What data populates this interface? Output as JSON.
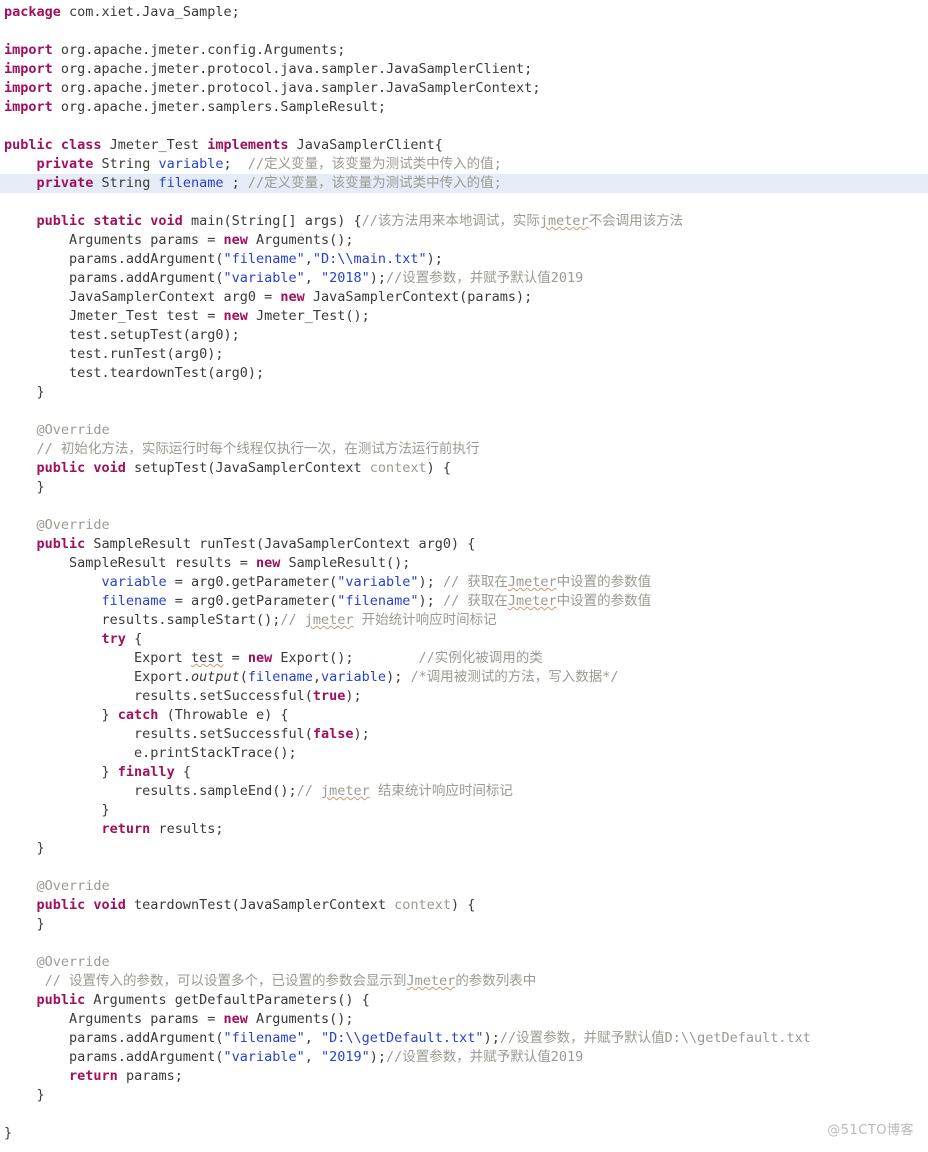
{
  "document": {
    "kind": "java-source-screenshot",
    "language": "Java",
    "watermark": "@51CTO博客",
    "highlighted_line_index": 8
  },
  "theme": {
    "background": "#ffffff",
    "plain_text": "#3a3a38",
    "keyword": "#a0105c",
    "string": "#2741d1",
    "comment": "#9a9a93",
    "field": "#2741d1",
    "annotation": "#9a9a93",
    "current_line_highlight": "#e6ecf7",
    "watermark_color": "#b9b9b9",
    "spellcheck_underline": "#cc9b77"
  },
  "code": {
    "lines": [
      {
        "n": 1,
        "tokens": [
          {
            "t": "package",
            "c": "kw"
          },
          {
            "t": " com.xiet.Java_Sample;",
            "c": "plain"
          }
        ]
      },
      {
        "n": 2,
        "tokens": []
      },
      {
        "n": 3,
        "tokens": [
          {
            "t": "import",
            "c": "kw"
          },
          {
            "t": " org.apache.jmeter.config.Arguments;",
            "c": "plain"
          }
        ]
      },
      {
        "n": 4,
        "tokens": [
          {
            "t": "import",
            "c": "kw"
          },
          {
            "t": " org.apache.jmeter.protocol.java.sampler.JavaSamplerClient;",
            "c": "plain"
          }
        ]
      },
      {
        "n": 5,
        "tokens": [
          {
            "t": "import",
            "c": "kw"
          },
          {
            "t": " org.apache.jmeter.protocol.java.sampler.JavaSamplerContext;",
            "c": "plain"
          }
        ]
      },
      {
        "n": 6,
        "tokens": [
          {
            "t": "import",
            "c": "kw"
          },
          {
            "t": " org.apache.jmeter.samplers.SampleResult;",
            "c": "plain"
          }
        ]
      },
      {
        "n": 7,
        "tokens": []
      },
      {
        "n": 8,
        "tokens": [
          {
            "t": "public class",
            "c": "kw"
          },
          {
            "t": " Jmeter_Test ",
            "c": "plain"
          },
          {
            "t": "implements",
            "c": "kw"
          },
          {
            "t": " JavaSamplerClient{",
            "c": "plain"
          }
        ]
      },
      {
        "n": 9,
        "tokens": [
          {
            "t": "    ",
            "c": "plain"
          },
          {
            "t": "private",
            "c": "kw"
          },
          {
            "t": " String ",
            "c": "plain"
          },
          {
            "t": "variable",
            "c": "fld"
          },
          {
            "t": ";  ",
            "c": "plain"
          },
          {
            "t": "//定义变量，该变量为测试类中传入的值;",
            "c": "cmt"
          }
        ]
      },
      {
        "n": 10,
        "tokens": [
          {
            "t": "    ",
            "c": "plain"
          },
          {
            "t": "private",
            "c": "kw"
          },
          {
            "t": " String ",
            "c": "plain"
          },
          {
            "t": "filename",
            "c": "fld"
          },
          {
            "t": " ; ",
            "c": "plain"
          },
          {
            "t": "//定义变量，该变量为测试类中传入的值;",
            "c": "cmt"
          }
        ]
      },
      {
        "n": 11,
        "tokens": []
      },
      {
        "n": 12,
        "tokens": [
          {
            "t": "    ",
            "c": "plain"
          },
          {
            "t": "public static void",
            "c": "kw"
          },
          {
            "t": " main(String[] args) {",
            "c": "plain"
          },
          {
            "t": "//该方法用来本地调试，实际",
            "c": "cmt"
          },
          {
            "t": "jmeter",
            "c": "cmt wavy"
          },
          {
            "t": "不会调用该方法",
            "c": "cmt"
          }
        ]
      },
      {
        "n": 13,
        "tokens": [
          {
            "t": "        Arguments params = ",
            "c": "plain"
          },
          {
            "t": "new",
            "c": "kw"
          },
          {
            "t": " Arguments();",
            "c": "plain"
          }
        ]
      },
      {
        "n": 14,
        "tokens": [
          {
            "t": "        params.addArgument(",
            "c": "plain"
          },
          {
            "t": "\"filename\"",
            "c": "str"
          },
          {
            "t": ",",
            "c": "plain"
          },
          {
            "t": "\"D:\\\\main.txt\"",
            "c": "str"
          },
          {
            "t": ");",
            "c": "plain"
          }
        ]
      },
      {
        "n": 15,
        "tokens": [
          {
            "t": "        params.addArgument(",
            "c": "plain"
          },
          {
            "t": "\"variable\"",
            "c": "str"
          },
          {
            "t": ", ",
            "c": "plain"
          },
          {
            "t": "\"2018\"",
            "c": "str"
          },
          {
            "t": ");",
            "c": "plain"
          },
          {
            "t": "//设置参数，并赋予默认值2019",
            "c": "cmt"
          }
        ]
      },
      {
        "n": 16,
        "tokens": [
          {
            "t": "        JavaSamplerContext arg0 = ",
            "c": "plain"
          },
          {
            "t": "new",
            "c": "kw"
          },
          {
            "t": " JavaSamplerContext(params);",
            "c": "plain"
          }
        ]
      },
      {
        "n": 17,
        "tokens": [
          {
            "t": "        Jmeter_Test test = ",
            "c": "plain"
          },
          {
            "t": "new",
            "c": "kw"
          },
          {
            "t": " Jmeter_Test();",
            "c": "plain"
          }
        ]
      },
      {
        "n": 18,
        "tokens": [
          {
            "t": "        test.setupTest(arg0);",
            "c": "plain"
          }
        ]
      },
      {
        "n": 19,
        "tokens": [
          {
            "t": "        test.runTest(arg0);",
            "c": "plain"
          }
        ]
      },
      {
        "n": 20,
        "tokens": [
          {
            "t": "        test.teardownTest(arg0);",
            "c": "plain"
          }
        ]
      },
      {
        "n": 21,
        "tokens": [
          {
            "t": "    }",
            "c": "plain"
          }
        ]
      },
      {
        "n": 22,
        "tokens": []
      },
      {
        "n": 23,
        "tokens": [
          {
            "t": "    @Override",
            "c": "ann"
          }
        ]
      },
      {
        "n": 24,
        "tokens": [
          {
            "t": "    // 初始化方法，实际运行时每个线程仅执行一次，在测试方法运行前执行",
            "c": "cmt"
          }
        ]
      },
      {
        "n": 25,
        "tokens": [
          {
            "t": "    ",
            "c": "plain"
          },
          {
            "t": "public void",
            "c": "kw"
          },
          {
            "t": " setupTest(JavaSamplerContext ",
            "c": "plain"
          },
          {
            "t": "context",
            "c": "cmt"
          },
          {
            "t": ") {",
            "c": "plain"
          }
        ]
      },
      {
        "n": 26,
        "tokens": [
          {
            "t": "    }",
            "c": "plain"
          }
        ]
      },
      {
        "n": 27,
        "tokens": []
      },
      {
        "n": 28,
        "tokens": [
          {
            "t": "    @Override",
            "c": "ann"
          }
        ]
      },
      {
        "n": 29,
        "tokens": [
          {
            "t": "    ",
            "c": "plain"
          },
          {
            "t": "public",
            "c": "kw"
          },
          {
            "t": " SampleResult runTest(JavaSamplerContext arg0) {",
            "c": "plain"
          }
        ]
      },
      {
        "n": 30,
        "tokens": [
          {
            "t": "        SampleResult results = ",
            "c": "plain"
          },
          {
            "t": "new",
            "c": "kw"
          },
          {
            "t": " SampleResult();",
            "c": "plain"
          }
        ]
      },
      {
        "n": 31,
        "tokens": [
          {
            "t": "            ",
            "c": "plain"
          },
          {
            "t": "variable",
            "c": "fld"
          },
          {
            "t": " = arg0.getParameter(",
            "c": "plain"
          },
          {
            "t": "\"variable\"",
            "c": "str"
          },
          {
            "t": "); ",
            "c": "plain"
          },
          {
            "t": "// 获取在",
            "c": "cmt"
          },
          {
            "t": "Jmeter",
            "c": "cmt wavy"
          },
          {
            "t": "中设置的参数值",
            "c": "cmt"
          }
        ]
      },
      {
        "n": 32,
        "tokens": [
          {
            "t": "            ",
            "c": "plain"
          },
          {
            "t": "filename",
            "c": "fld"
          },
          {
            "t": " = arg0.getParameter(",
            "c": "plain"
          },
          {
            "t": "\"filename\"",
            "c": "str"
          },
          {
            "t": "); ",
            "c": "plain"
          },
          {
            "t": "// 获取在",
            "c": "cmt"
          },
          {
            "t": "Jmeter",
            "c": "cmt wavy"
          },
          {
            "t": "中设置的参数值",
            "c": "cmt"
          }
        ]
      },
      {
        "n": 33,
        "tokens": [
          {
            "t": "            results.sampleStart();",
            "c": "plain"
          },
          {
            "t": "// ",
            "c": "cmt"
          },
          {
            "t": "jmeter",
            "c": "cmt wavy"
          },
          {
            "t": " 开始统计响应时间标记",
            "c": "cmt"
          }
        ]
      },
      {
        "n": 34,
        "tokens": [
          {
            "t": "            ",
            "c": "plain"
          },
          {
            "t": "try",
            "c": "kw"
          },
          {
            "t": " {",
            "c": "plain"
          }
        ]
      },
      {
        "n": 35,
        "tokens": [
          {
            "t": "                Export ",
            "c": "plain"
          },
          {
            "t": "test",
            "c": "plain wavy"
          },
          {
            "t": " = ",
            "c": "plain"
          },
          {
            "t": "new",
            "c": "kw"
          },
          {
            "t": " Export();        ",
            "c": "plain"
          },
          {
            "t": "//实例化被调用的类",
            "c": "cmt"
          }
        ]
      },
      {
        "n": 36,
        "tokens": [
          {
            "t": "                Export.",
            "c": "plain"
          },
          {
            "t": "output",
            "c": "plain ital"
          },
          {
            "t": "(",
            "c": "plain"
          },
          {
            "t": "filename",
            "c": "fld"
          },
          {
            "t": ",",
            "c": "plain"
          },
          {
            "t": "variable",
            "c": "fld"
          },
          {
            "t": "); ",
            "c": "plain"
          },
          {
            "t": "/*调用被测试的方法，写入数据*/",
            "c": "cmt"
          }
        ]
      },
      {
        "n": 37,
        "tokens": [
          {
            "t": "                results.setSuccessful(",
            "c": "plain"
          },
          {
            "t": "true",
            "c": "kw"
          },
          {
            "t": ");",
            "c": "plain"
          }
        ]
      },
      {
        "n": 38,
        "tokens": [
          {
            "t": "            } ",
            "c": "plain"
          },
          {
            "t": "catch",
            "c": "kw"
          },
          {
            "t": " (Throwable e) {",
            "c": "plain"
          }
        ]
      },
      {
        "n": 39,
        "tokens": [
          {
            "t": "                results.setSuccessful(",
            "c": "plain"
          },
          {
            "t": "false",
            "c": "kw"
          },
          {
            "t": ");",
            "c": "plain"
          }
        ]
      },
      {
        "n": 40,
        "tokens": [
          {
            "t": "                e.printStackTrace();",
            "c": "plain"
          }
        ]
      },
      {
        "n": 41,
        "tokens": [
          {
            "t": "            } ",
            "c": "plain"
          },
          {
            "t": "finally",
            "c": "kw"
          },
          {
            "t": " {",
            "c": "plain"
          }
        ]
      },
      {
        "n": 42,
        "tokens": [
          {
            "t": "                results.sampleEnd();",
            "c": "plain"
          },
          {
            "t": "// ",
            "c": "cmt"
          },
          {
            "t": "jmeter",
            "c": "cmt wavy"
          },
          {
            "t": " 结束统计响应时间标记",
            "c": "cmt"
          }
        ]
      },
      {
        "n": 43,
        "tokens": [
          {
            "t": "            }",
            "c": "plain"
          }
        ]
      },
      {
        "n": 44,
        "tokens": [
          {
            "t": "            ",
            "c": "plain"
          },
          {
            "t": "return",
            "c": "kw"
          },
          {
            "t": " results;",
            "c": "plain"
          }
        ]
      },
      {
        "n": 45,
        "tokens": [
          {
            "t": "    }",
            "c": "plain"
          }
        ]
      },
      {
        "n": 46,
        "tokens": []
      },
      {
        "n": 47,
        "tokens": [
          {
            "t": "    @Override",
            "c": "ann"
          }
        ]
      },
      {
        "n": 48,
        "tokens": [
          {
            "t": "    ",
            "c": "plain"
          },
          {
            "t": "public void",
            "c": "kw"
          },
          {
            "t": " teardownTest(JavaSamplerContext ",
            "c": "plain"
          },
          {
            "t": "context",
            "c": "cmt"
          },
          {
            "t": ") {",
            "c": "plain"
          }
        ]
      },
      {
        "n": 49,
        "tokens": [
          {
            "t": "    }",
            "c": "plain"
          }
        ]
      },
      {
        "n": 50,
        "tokens": []
      },
      {
        "n": 51,
        "tokens": [
          {
            "t": "    @Override",
            "c": "ann"
          }
        ]
      },
      {
        "n": 52,
        "tokens": [
          {
            "t": "     // 设置传入的参数，可以设置多个，已设置的参数会显示到",
            "c": "cmt"
          },
          {
            "t": "Jmeter",
            "c": "cmt wavy"
          },
          {
            "t": "的参数列表中",
            "c": "cmt"
          }
        ]
      },
      {
        "n": 53,
        "tokens": [
          {
            "t": "    ",
            "c": "plain"
          },
          {
            "t": "public",
            "c": "kw"
          },
          {
            "t": " Arguments getDefaultParameters() {",
            "c": "plain"
          }
        ]
      },
      {
        "n": 54,
        "tokens": [
          {
            "t": "        Arguments params = ",
            "c": "plain"
          },
          {
            "t": "new",
            "c": "kw"
          },
          {
            "t": " Arguments();",
            "c": "plain"
          }
        ]
      },
      {
        "n": 55,
        "tokens": [
          {
            "t": "        params.addArgument(",
            "c": "plain"
          },
          {
            "t": "\"filename\"",
            "c": "str"
          },
          {
            "t": ", ",
            "c": "plain"
          },
          {
            "t": "\"D:\\\\getDefault.txt\"",
            "c": "str"
          },
          {
            "t": ");",
            "c": "plain"
          },
          {
            "t": "//设置参数，并赋予默认值D:\\\\getDefault.txt",
            "c": "cmt"
          }
        ]
      },
      {
        "n": 56,
        "tokens": [
          {
            "t": "        params.addArgument(",
            "c": "plain"
          },
          {
            "t": "\"variable\"",
            "c": "str"
          },
          {
            "t": ", ",
            "c": "plain"
          },
          {
            "t": "\"2019\"",
            "c": "str"
          },
          {
            "t": ");",
            "c": "plain"
          },
          {
            "t": "//设置参数，并赋予默认值2019",
            "c": "cmt"
          }
        ]
      },
      {
        "n": 57,
        "tokens": [
          {
            "t": "        ",
            "c": "plain"
          },
          {
            "t": "return",
            "c": "kw"
          },
          {
            "t": " params;",
            "c": "plain"
          }
        ]
      },
      {
        "n": 58,
        "tokens": [
          {
            "t": "    }",
            "c": "plain"
          }
        ]
      },
      {
        "n": 59,
        "tokens": []
      },
      {
        "n": 60,
        "tokens": [
          {
            "t": "}",
            "c": "plain"
          }
        ]
      }
    ]
  }
}
